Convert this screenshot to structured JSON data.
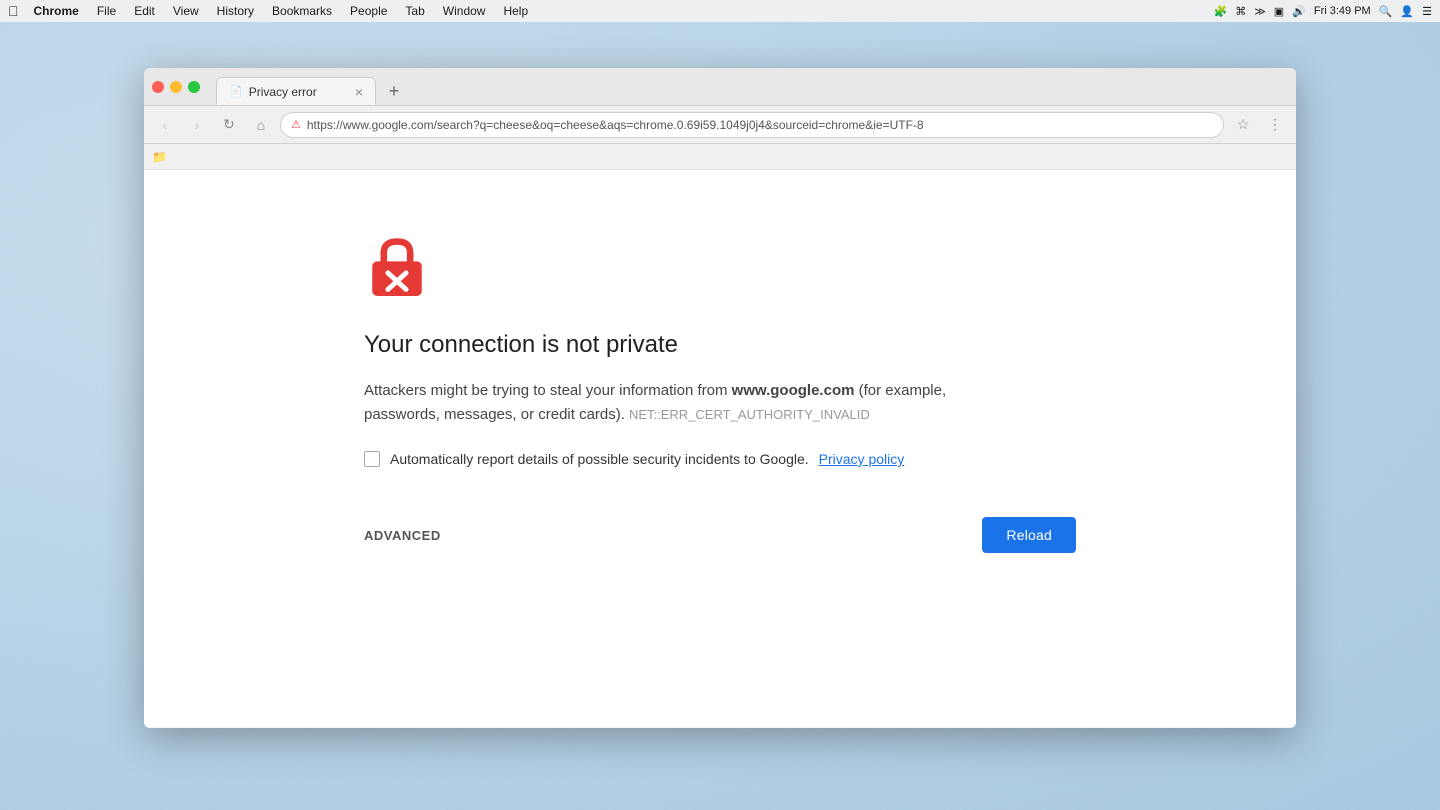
{
  "desktop": {
    "background_color": "#b8d4e8"
  },
  "menu_bar": {
    "apple_symbol": "",
    "items": [
      "Chrome",
      "File",
      "Edit",
      "View",
      "History",
      "Bookmarks",
      "People",
      "Tab",
      "Window",
      "Help"
    ],
    "right": {
      "time": "Fri 3:49 PM"
    }
  },
  "browser": {
    "tab": {
      "label": "Privacy error",
      "icon": "📄"
    },
    "nav": {
      "back_disabled": true,
      "forward_disabled": true,
      "url": "https://www.google.com/search?q=cheese&oq=cheese&aqs=chrome.0.69i59.1049j0j4&sourceid=chrome&ie=UTF-8"
    },
    "error_page": {
      "title": "Your connection is not private",
      "description_prefix": "Attackers might be trying to steal your information from ",
      "domain": "www.google.com",
      "description_suffix": " (for example, passwords, messages, or credit cards).",
      "error_code": "NET::ERR_CERT_AUTHORITY_INVALID",
      "checkbox_label": "Automatically report details of possible security incidents to Google.",
      "privacy_policy_link": "Privacy policy",
      "advanced_button": "ADVANCED",
      "reload_button": "Reload"
    }
  }
}
